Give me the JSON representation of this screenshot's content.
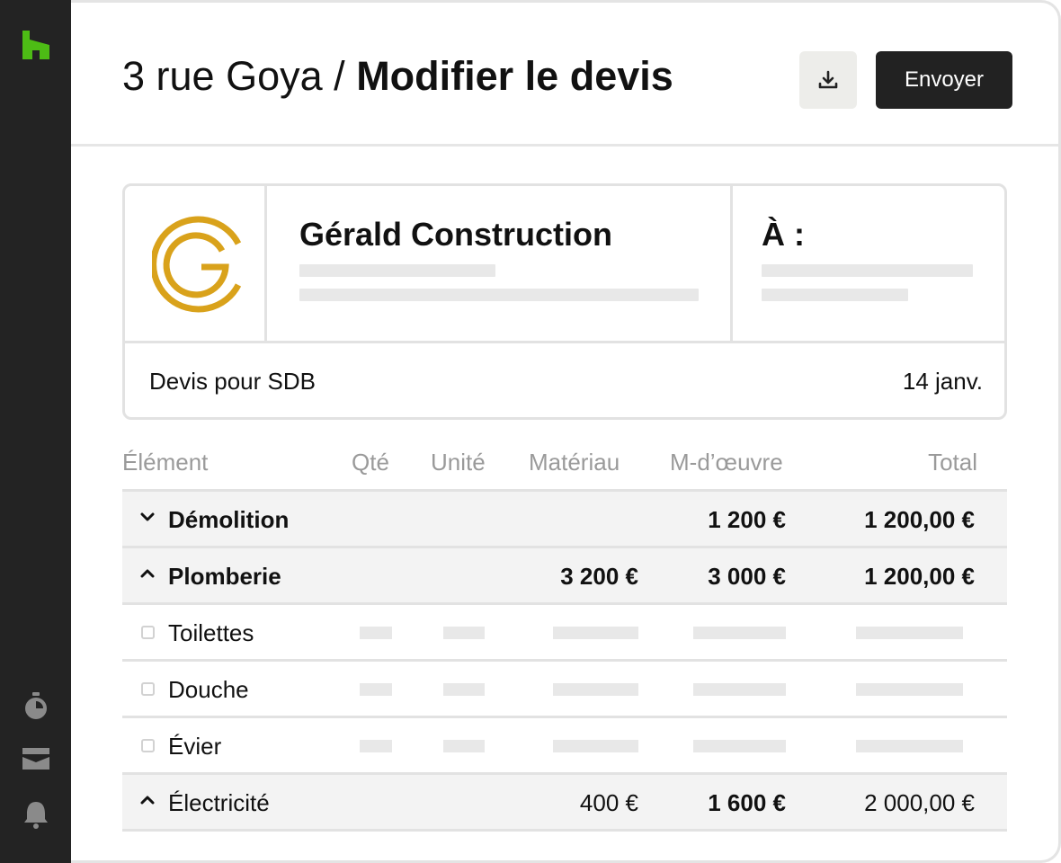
{
  "header": {
    "project": "3 rue Goya",
    "separator": "/",
    "page_title": "Modifier le devis",
    "send_label": "Envoyer"
  },
  "quote": {
    "company_name": "Gérald Construction",
    "recipient_label": "À :",
    "description": "Devis pour SDB",
    "date": "14 janv."
  },
  "table": {
    "columns": [
      "Élément",
      "Qté",
      "Unité",
      "Matériau",
      "M-d’œuvre",
      "Total"
    ],
    "rows": [
      {
        "type": "category",
        "expanded": false,
        "label": "Démolition",
        "materiau": "",
        "main_oeuvre": "1 200 €",
        "total": "1 200,00 €"
      },
      {
        "type": "category",
        "expanded": true,
        "label": "Plomberie",
        "materiau": "3 200 €",
        "main_oeuvre": "3 000 €",
        "total": "1 200,00 €"
      },
      {
        "type": "item",
        "label": "Toilettes"
      },
      {
        "type": "item",
        "label": "Douche"
      },
      {
        "type": "item",
        "label": "Évier"
      },
      {
        "type": "category",
        "expanded": true,
        "label": "Électricité",
        "materiau": "400 €",
        "main_oeuvre": "1 600 €",
        "total": "2 000,00 €"
      }
    ]
  },
  "sidebar": {
    "icons": [
      "houzz-logo-icon",
      "timer-icon",
      "inbox-icon",
      "bell-icon"
    ]
  },
  "colors": {
    "brand_green": "#4dbc15",
    "logo_gold": "#d9a21b",
    "sidebar_bg": "#232323",
    "send_button_bg": "#222222"
  }
}
